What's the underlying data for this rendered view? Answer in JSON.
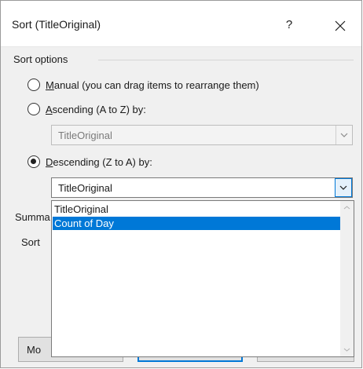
{
  "dialog": {
    "title": "Sort (TitleOriginal)",
    "help_label": "?"
  },
  "sort_options": {
    "group_label": "Sort options",
    "manual": {
      "accel": "M",
      "label_rest": "anual (you can drag items to rearrange them)",
      "checked": false
    },
    "ascending": {
      "accel": "A",
      "label_rest": "scending (A to Z) by:",
      "checked": false,
      "field_value": "TitleOriginal"
    },
    "descending": {
      "accel": "D",
      "label_rest": "escending (Z to A) by:",
      "checked": true,
      "field_value": "TitleOriginal"
    }
  },
  "dropdown": {
    "options": [
      "TitleOriginal",
      "Count of Day"
    ],
    "highlighted": "Count of Day"
  },
  "summary": {
    "label_partial": "Summa",
    "sort_partial": "Sort"
  },
  "buttons": {
    "more_partial": "Mo"
  },
  "colors": {
    "accent": "#0078d7",
    "selection_text": "#ffffff",
    "dialog_bg": "#f0f0f0"
  },
  "icons": {
    "close": "close-icon",
    "combo_arrow": "chevron-down-icon",
    "scroll_up": "chevron-up-icon",
    "scroll_down": "chevron-down-icon"
  }
}
